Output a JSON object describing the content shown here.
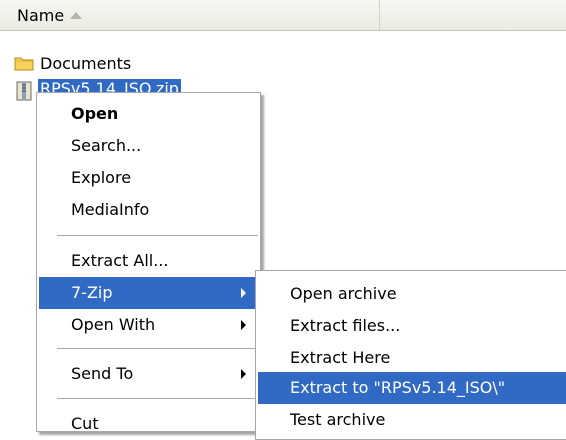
{
  "header": {
    "name_label": "Name"
  },
  "files": [
    {
      "name": "Documents",
      "icon": "folder-icon"
    },
    {
      "name": "RPSv5.14_ISO.zip",
      "icon": "zip-archive-icon"
    }
  ],
  "context_menu": {
    "open": "Open",
    "search": "Search...",
    "explore": "Explore",
    "mediainfo": "MediaInfo",
    "extract_all": "Extract All...",
    "seven_zip": "7-Zip",
    "open_with": "Open With",
    "send_to": "Send To",
    "cut": "Cut"
  },
  "submenu": {
    "open_archive": "Open archive",
    "extract_files": "Extract files...",
    "extract_here": "Extract Here",
    "extract_to": "Extract to \"RPSv5.14_ISO\\\"",
    "test_archive": "Test archive"
  },
  "colors": {
    "selection": "#316ac5",
    "menu_border": "#a7a6aa"
  }
}
